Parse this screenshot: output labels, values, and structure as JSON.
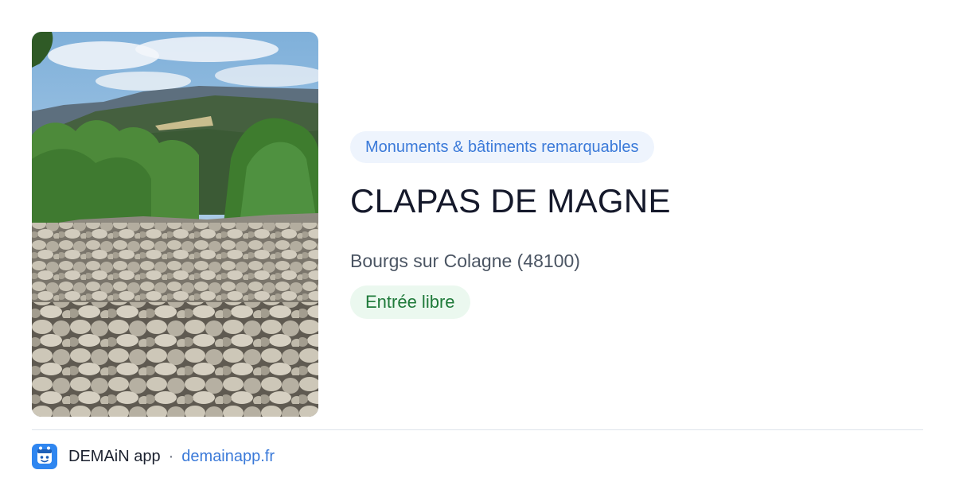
{
  "card": {
    "photo_alt": "CLAPAS DE MAGNE",
    "category": "Monuments & bâtiments remarquables",
    "title": "CLAPAS DE MAGNE",
    "location": "Bourgs sur Colagne (48100)",
    "access": "Entrée libre"
  },
  "footer": {
    "logo_icon": "demain-app-logo-icon",
    "app_name": "DEMAiN app",
    "separator": "·",
    "url": "demainapp.fr"
  },
  "colors": {
    "category_badge_bg": "#eef4fd",
    "category_text": "#3b7ad9",
    "access_badge_bg": "#ebf8ef",
    "access_text": "#1f7a3a",
    "title_text": "#15192b",
    "link": "#3b7ad9",
    "logo_bg": "#2f86f0"
  }
}
